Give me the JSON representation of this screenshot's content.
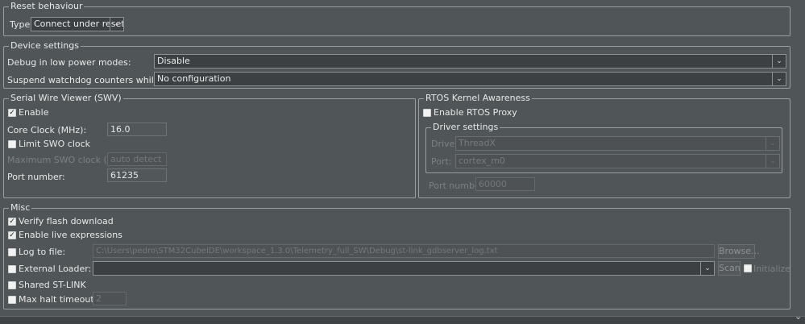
{
  "reset_behaviour": {
    "title": "Reset behaviour",
    "type_label": "Type:",
    "type_value": "Connect under reset"
  },
  "device_settings": {
    "title": "Device settings",
    "debug_low_power_label": "Debug in low power modes:",
    "debug_low_power_value": "Disable",
    "suspend_watchdog_label": "Suspend watchdog counters while halted:",
    "suspend_watchdog_value": "No configuration"
  },
  "swv": {
    "title": "Serial Wire Viewer (SWV)",
    "enable_label": "Enable",
    "enable_checked": true,
    "core_clock_label": "Core Clock (MHz):",
    "core_clock_value": "16.0",
    "limit_swo_label": "Limit SWO clock",
    "limit_swo_checked": false,
    "max_swo_label": "Maximum SWO clock (kHz):",
    "max_swo_value": "auto detect",
    "port_label": "Port number:",
    "port_value": "61235"
  },
  "rtos": {
    "title": "RTOS Kernel Awareness",
    "enable_proxy_label": "Enable RTOS Proxy",
    "enable_proxy_checked": false,
    "driver_settings_title": "Driver settings",
    "driver_label": "Driver:",
    "driver_value": "ThreadX",
    "port_label": "Port:",
    "port_value": "cortex_m0",
    "port_number_label": "Port number:",
    "port_number_value": "60000"
  },
  "misc": {
    "title": "Misc",
    "verify_flash_label": "Verify flash download",
    "verify_flash_checked": true,
    "live_expr_label": "Enable live expressions",
    "live_expr_checked": true,
    "log_file_label": "Log to file:",
    "log_file_checked": false,
    "log_file_path": "C:\\Users\\pedro\\STM32CubeIDE\\workspace_1.3.0\\Telemetry_full_SW\\Debug\\st-link_gdbserver_log.txt",
    "browse_label": "Browse...",
    "external_loader_label": "External Loader:",
    "external_loader_checked": false,
    "external_loader_value": "",
    "scan_label": "Scan",
    "initialize_label": "Initialize",
    "initialize_checked": false,
    "shared_stlink_label": "Shared ST-LINK",
    "shared_stlink_checked": false,
    "max_halt_label": "Max halt timeout(s):",
    "max_halt_checked": false,
    "max_halt_value": "2"
  },
  "icons": {
    "check": "✓",
    "chevron": "❯"
  }
}
